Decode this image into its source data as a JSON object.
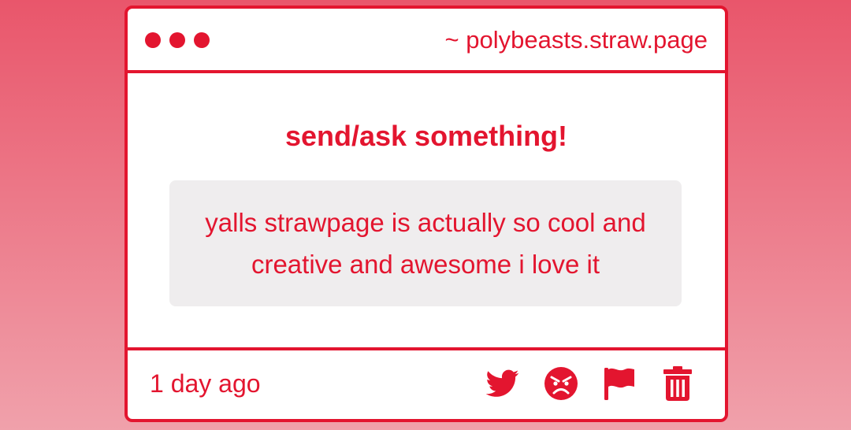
{
  "colors": {
    "accent": "#e3152f",
    "card_background": "#ffffff",
    "message_background": "#efedee",
    "page_gradient_top": "#e9566b",
    "page_gradient_bottom": "#f0a1ab"
  },
  "window": {
    "dots": [
      "dot-1",
      "dot-2",
      "dot-3"
    ],
    "url": "~ polybeasts.straw.page"
  },
  "content": {
    "heading": "send/ask something!",
    "message": "yalls strawpage is actually so cool and creative and awesome i love it"
  },
  "footer": {
    "timestamp": "1 day ago",
    "actions": [
      {
        "icon": "twitter-icon"
      },
      {
        "icon": "angry-face-icon"
      },
      {
        "icon": "flag-icon"
      },
      {
        "icon": "trash-icon"
      }
    ]
  }
}
